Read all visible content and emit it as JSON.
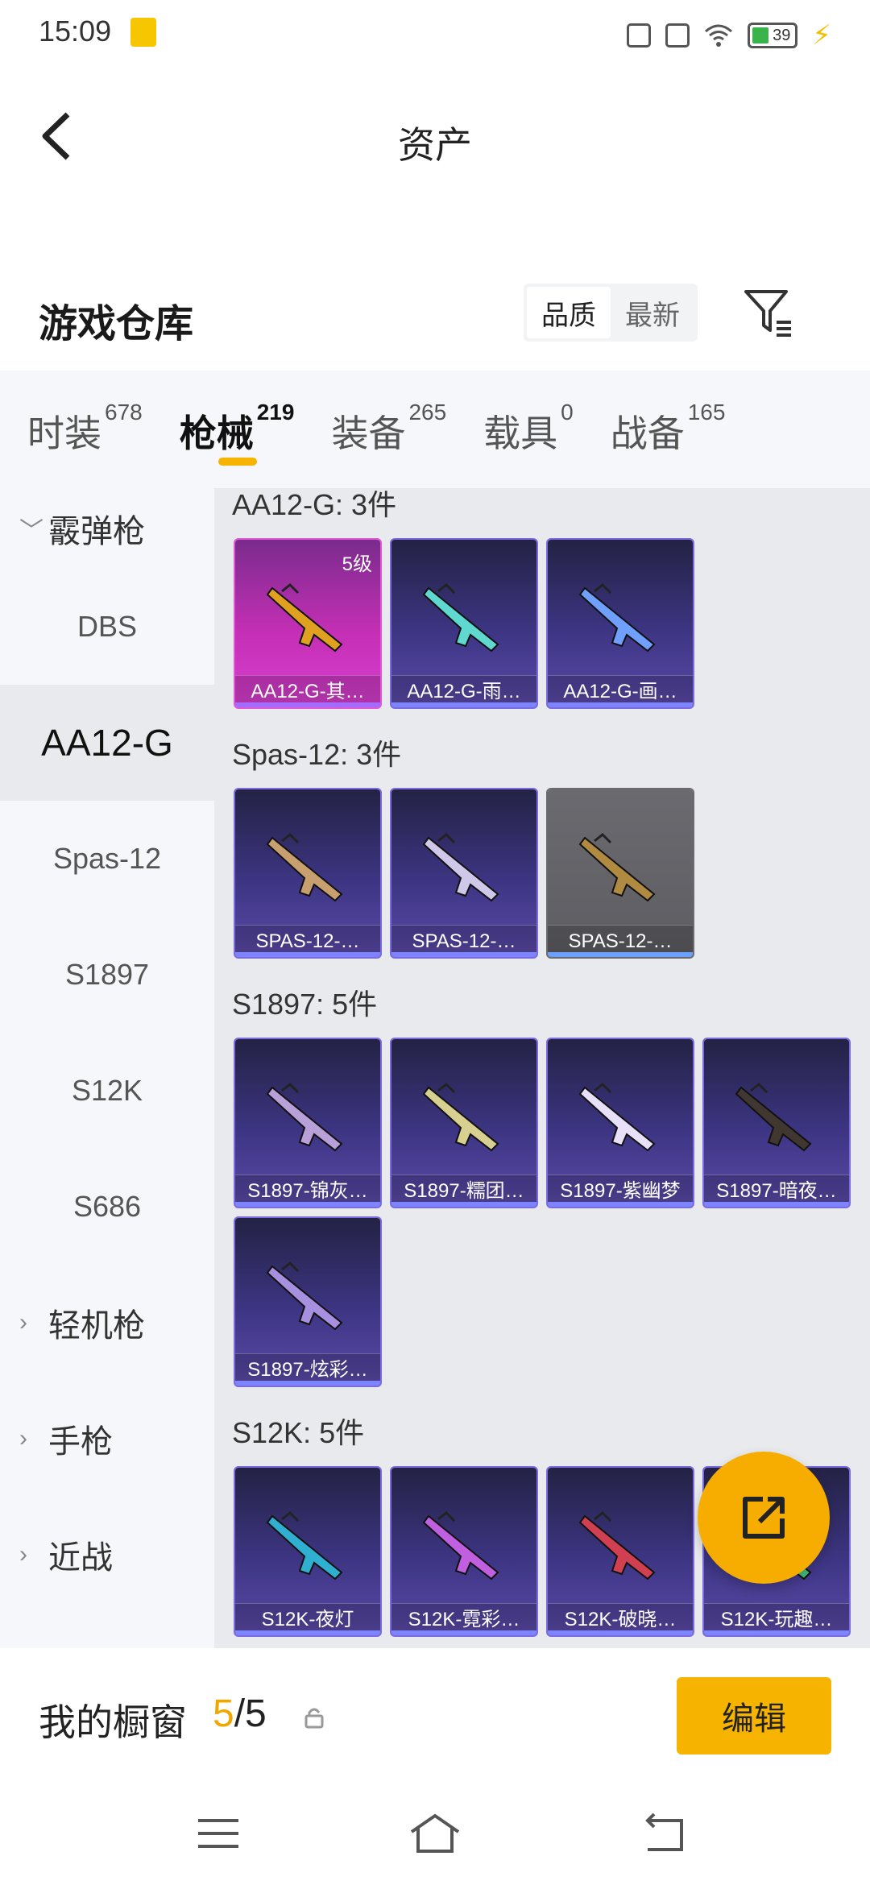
{
  "status_bar": {
    "time": "15:09",
    "battery": "39"
  },
  "header": {
    "title": "资产"
  },
  "warehouse": {
    "title": "游戏仓库",
    "sort_options": [
      "品质",
      "最新"
    ],
    "active_sort": "品质"
  },
  "tabs": [
    {
      "label": "时装",
      "count": "678"
    },
    {
      "label": "枪械",
      "count": "219",
      "active": true
    },
    {
      "label": "装备",
      "count": "265"
    },
    {
      "label": "载具",
      "count": "0"
    },
    {
      "label": "战备",
      "count": "165"
    }
  ],
  "sidebar": {
    "group_shotgun": "霰弹枪",
    "items": [
      "DBS",
      "AA12-G",
      "Spas-12",
      "S1897",
      "S12K",
      "S686"
    ],
    "active_item": "AA12-G",
    "group_lmg": "轻机枪",
    "group_pistol": "手枪",
    "group_melee": "近战"
  },
  "sections": [
    {
      "title": "AA12-G: 3件",
      "items": [
        {
          "name": "AA12-G-其…",
          "level": "5级",
          "style": "pink"
        },
        {
          "name": "AA12-G-雨…",
          "style": "purple"
        },
        {
          "name": "AA12-G-画…",
          "style": "purple"
        }
      ]
    },
    {
      "title": "Spas-12: 3件",
      "items": [
        {
          "name": "SPAS-12-…",
          "style": "purple"
        },
        {
          "name": "SPAS-12-…",
          "style": "purple"
        },
        {
          "name": "SPAS-12-…",
          "style": "gray"
        }
      ]
    },
    {
      "title": "S1897: 5件",
      "items": [
        {
          "name": "S1897-锦灰…",
          "style": "purple"
        },
        {
          "name": "S1897-糯团…",
          "style": "purple"
        },
        {
          "name": "S1897-紫幽梦",
          "style": "purple"
        },
        {
          "name": "S1897-暗夜…",
          "style": "purple"
        },
        {
          "name": "S1897-炫彩…",
          "style": "purple"
        }
      ]
    },
    {
      "title": "S12K: 5件",
      "items": [
        {
          "name": "S12K-夜灯",
          "style": "purple"
        },
        {
          "name": "S12K-霓彩…",
          "style": "purple"
        },
        {
          "name": "S12K-破晓…",
          "style": "purple"
        },
        {
          "name": "S12K-玩趣…",
          "style": "purple"
        }
      ]
    }
  ],
  "showcase": {
    "label": "我的橱窗",
    "current": "5",
    "total": "/5",
    "edit_label": "编辑"
  },
  "colors": {
    "accent": "#f6b400",
    "card_purple": "#3d3583",
    "card_pink": "#c42fb5"
  },
  "icons": [
    "back-arrow-icon",
    "filter-icon",
    "share-icon",
    "lock-icon",
    "menu-icon",
    "home-icon",
    "back-nav-icon"
  ]
}
